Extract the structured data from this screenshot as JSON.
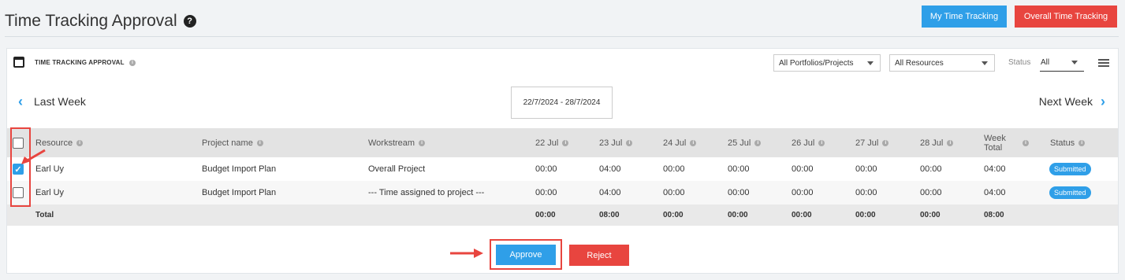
{
  "header": {
    "title": "Time Tracking Approval",
    "help_glyph": "?",
    "my_time_tracking": "My Time Tracking",
    "overall_time_tracking": "Overall Time Tracking"
  },
  "card": {
    "title": "TIME TRACKING APPROVAL",
    "info_glyph": "i",
    "filters": {
      "portfolios": "All Portfolios/Projects",
      "resources": "All Resources",
      "status_label": "Status",
      "status_value": "All"
    },
    "nav": {
      "prev_label": "Last Week",
      "next_label": "Next Week",
      "prev_icon": "‹",
      "next_icon": "›",
      "date_range": "22/7/2024 - 28/7/2024"
    }
  },
  "table": {
    "headers": {
      "resource": "Resource",
      "project": "Project name",
      "workstream": "Workstream",
      "d1": "22 Jul",
      "d2": "23 Jul",
      "d3": "24 Jul",
      "d4": "25 Jul",
      "d5": "26 Jul",
      "d6": "27 Jul",
      "d7": "28 Jul",
      "week_total": "Week Total",
      "status": "Status"
    },
    "rows": [
      {
        "checked": true,
        "check_glyph": "✓",
        "resource": "Earl Uy",
        "project": "Budget Import Plan",
        "workstream": "Overall Project",
        "d1": "00:00",
        "d2": "04:00",
        "d3": "00:00",
        "d4": "00:00",
        "d5": "00:00",
        "d6": "00:00",
        "d7": "00:00",
        "week_total": "04:00",
        "status": "Submitted"
      },
      {
        "checked": false,
        "check_glyph": "",
        "resource": "Earl Uy",
        "project": "Budget Import Plan",
        "workstream": "--- Time assigned to project ---",
        "d1": "00:00",
        "d2": "04:00",
        "d3": "00:00",
        "d4": "00:00",
        "d5": "00:00",
        "d6": "00:00",
        "d7": "00:00",
        "week_total": "04:00",
        "status": "Submitted"
      }
    ],
    "total": {
      "label": "Total",
      "d1": "00:00",
      "d2": "08:00",
      "d3": "00:00",
      "d4": "00:00",
      "d5": "00:00",
      "d6": "00:00",
      "d7": "00:00",
      "week_total": "08:00"
    }
  },
  "actions": {
    "approve": "Approve",
    "reject": "Reject"
  },
  "colors": {
    "accent_blue": "#2f9fe8",
    "danger_red": "#e8453f",
    "annotation_red": "#e8453f"
  }
}
